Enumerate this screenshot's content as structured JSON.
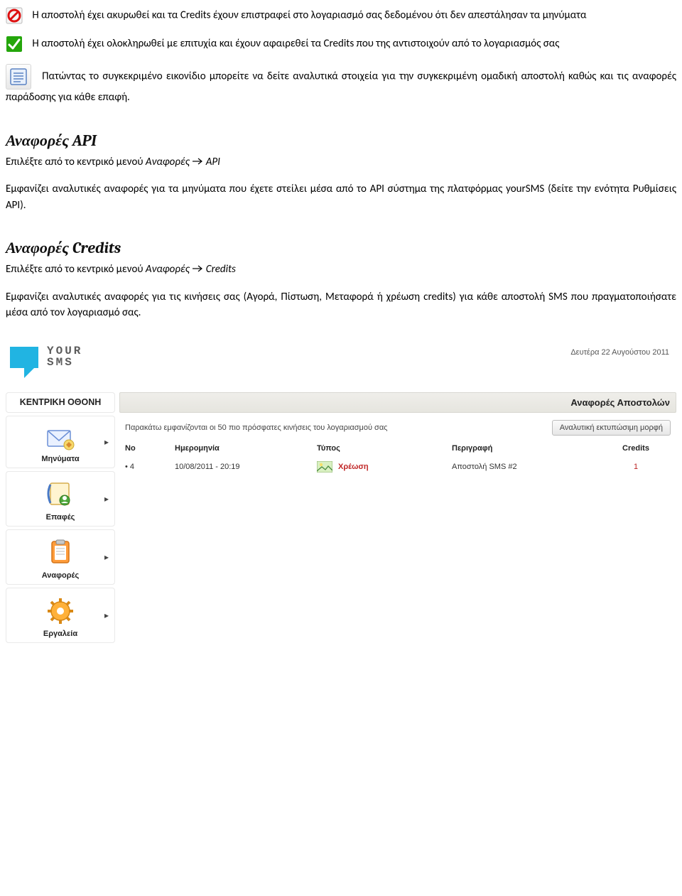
{
  "icons": {
    "cancel": "cancel-icon",
    "check": "check-icon",
    "details": "details-icon"
  },
  "paragraphs": {
    "p1": "Η αποστολή έχει ακυρωθεί και τα Credits έχουν επιστραφεί στο λογαριασμό σας δεδομένου ότι δεν απεστάλησαν τα μηνύματα",
    "p2": "Η αποστολή έχει ολοκληρωθεί με επιτυχία και έχουν αφαιρεθεί τα Credits που της αντιστοιχούν από το λογαριασμός σας",
    "p3": "Πατώντας το συγκεκριμένο εικονίδιο μπορείτε να δείτε αναλυτικά στοιχεία για την συγκεκριμένη ομαδική αποστολή καθώς και τις αναφορές παράδοσης για κάθε επαφή."
  },
  "sections": {
    "api": {
      "heading": "Αναφορές API",
      "menu_prefix": "Επιλέξτε από το κεντρικό μενού ",
      "menu_path1": "Αναφορές",
      "menu_path2": "API",
      "body": "Εμφανίζει αναλυτικές αναφορές για τα μηνύματα που έχετε στείλει μέσα από το API σύστημα της πλατφόρμας yourSMS (δείτε την ενότητα Ρυθμίσεις API)."
    },
    "credits": {
      "heading": "Αναφορές Credits",
      "menu_prefix": "Επιλέξτε από το κεντρικό μενού ",
      "menu_path1": "Αναφορές",
      "menu_path2": "Credits",
      "body": "Εμφανίζει αναλυτικές αναφορές για τις κινήσεις σας (Αγορά, Πίστωση, Μεταφορά ή χρέωση credits) για κάθε αποστολή SMS που πραγματοποιήσατε μέσα από τον λογαριασμό σας."
    }
  },
  "app": {
    "logo_line1": "YOUR",
    "logo_line2": "SMS",
    "date": "Δευτέρα 22 Αυγούστου 2011",
    "sidebar": {
      "header": "ΚΕΝΤΡΙΚΗ ΟΘΟΝΗ",
      "items": [
        {
          "label": "Μηνύματα",
          "icon": "mail"
        },
        {
          "label": "Επαφές",
          "icon": "contacts"
        },
        {
          "label": "Αναφορές",
          "icon": "reports"
        },
        {
          "label": "Εργαλεία",
          "icon": "tools"
        }
      ]
    },
    "panel": {
      "title": "Αναφορές Αποστολών",
      "subtitle": "Παρακάτω εμφανίζονται οι 50 πιο πρόσφατες κινήσεις του λογαριασμού σας",
      "print_button": "Αναλυτική εκτυπώσιμη μορφή",
      "columns": {
        "no": "No",
        "date": "Ημερομηνία",
        "type": "Τύπος",
        "desc": "Περιγραφή",
        "credits": "Credits"
      },
      "rows": [
        {
          "no": "4",
          "date": "10/08/2011 - 20:19",
          "type": "Χρέωση",
          "desc": "Αποστολή SMS #2",
          "credits": "1"
        }
      ]
    }
  }
}
